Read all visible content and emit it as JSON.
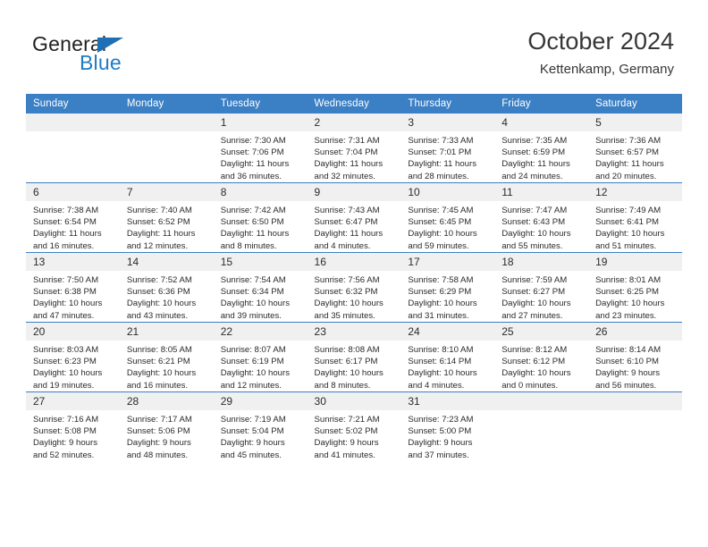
{
  "brand": {
    "name_top": "General",
    "name_bottom": "Blue",
    "accent_color": "#1f7ac4",
    "triangle_color": "#1f6fb5"
  },
  "header": {
    "title": "October 2024",
    "subtitle": "Kettenkamp, Germany"
  },
  "theme": {
    "header_row_bg": "#3b7fc4",
    "header_row_text": "#ffffff",
    "daynum_bg": "#f0f0f0",
    "cell_bg": "#ffffff",
    "row_rule": "#3b7fc4"
  },
  "weekday_headers": [
    "Sunday",
    "Monday",
    "Tuesday",
    "Wednesday",
    "Thursday",
    "Friday",
    "Saturday"
  ],
  "weeks": [
    [
      {
        "day": "",
        "empty": true,
        "lines": []
      },
      {
        "day": "",
        "empty": true,
        "lines": []
      },
      {
        "day": "1",
        "lines": [
          "Sunrise: 7:30 AM",
          "Sunset: 7:06 PM",
          "Daylight: 11 hours",
          "and 36 minutes."
        ]
      },
      {
        "day": "2",
        "lines": [
          "Sunrise: 7:31 AM",
          "Sunset: 7:04 PM",
          "Daylight: 11 hours",
          "and 32 minutes."
        ]
      },
      {
        "day": "3",
        "lines": [
          "Sunrise: 7:33 AM",
          "Sunset: 7:01 PM",
          "Daylight: 11 hours",
          "and 28 minutes."
        ]
      },
      {
        "day": "4",
        "lines": [
          "Sunrise: 7:35 AM",
          "Sunset: 6:59 PM",
          "Daylight: 11 hours",
          "and 24 minutes."
        ]
      },
      {
        "day": "5",
        "lines": [
          "Sunrise: 7:36 AM",
          "Sunset: 6:57 PM",
          "Daylight: 11 hours",
          "and 20 minutes."
        ]
      }
    ],
    [
      {
        "day": "6",
        "lines": [
          "Sunrise: 7:38 AM",
          "Sunset: 6:54 PM",
          "Daylight: 11 hours",
          "and 16 minutes."
        ]
      },
      {
        "day": "7",
        "lines": [
          "Sunrise: 7:40 AM",
          "Sunset: 6:52 PM",
          "Daylight: 11 hours",
          "and 12 minutes."
        ]
      },
      {
        "day": "8",
        "lines": [
          "Sunrise: 7:42 AM",
          "Sunset: 6:50 PM",
          "Daylight: 11 hours",
          "and 8 minutes."
        ]
      },
      {
        "day": "9",
        "lines": [
          "Sunrise: 7:43 AM",
          "Sunset: 6:47 PM",
          "Daylight: 11 hours",
          "and 4 minutes."
        ]
      },
      {
        "day": "10",
        "lines": [
          "Sunrise: 7:45 AM",
          "Sunset: 6:45 PM",
          "Daylight: 10 hours",
          "and 59 minutes."
        ]
      },
      {
        "day": "11",
        "lines": [
          "Sunrise: 7:47 AM",
          "Sunset: 6:43 PM",
          "Daylight: 10 hours",
          "and 55 minutes."
        ]
      },
      {
        "day": "12",
        "lines": [
          "Sunrise: 7:49 AM",
          "Sunset: 6:41 PM",
          "Daylight: 10 hours",
          "and 51 minutes."
        ]
      }
    ],
    [
      {
        "day": "13",
        "lines": [
          "Sunrise: 7:50 AM",
          "Sunset: 6:38 PM",
          "Daylight: 10 hours",
          "and 47 minutes."
        ]
      },
      {
        "day": "14",
        "lines": [
          "Sunrise: 7:52 AM",
          "Sunset: 6:36 PM",
          "Daylight: 10 hours",
          "and 43 minutes."
        ]
      },
      {
        "day": "15",
        "lines": [
          "Sunrise: 7:54 AM",
          "Sunset: 6:34 PM",
          "Daylight: 10 hours",
          "and 39 minutes."
        ]
      },
      {
        "day": "16",
        "lines": [
          "Sunrise: 7:56 AM",
          "Sunset: 6:32 PM",
          "Daylight: 10 hours",
          "and 35 minutes."
        ]
      },
      {
        "day": "17",
        "lines": [
          "Sunrise: 7:58 AM",
          "Sunset: 6:29 PM",
          "Daylight: 10 hours",
          "and 31 minutes."
        ]
      },
      {
        "day": "18",
        "lines": [
          "Sunrise: 7:59 AM",
          "Sunset: 6:27 PM",
          "Daylight: 10 hours",
          "and 27 minutes."
        ]
      },
      {
        "day": "19",
        "lines": [
          "Sunrise: 8:01 AM",
          "Sunset: 6:25 PM",
          "Daylight: 10 hours",
          "and 23 minutes."
        ]
      }
    ],
    [
      {
        "day": "20",
        "lines": [
          "Sunrise: 8:03 AM",
          "Sunset: 6:23 PM",
          "Daylight: 10 hours",
          "and 19 minutes."
        ]
      },
      {
        "day": "21",
        "lines": [
          "Sunrise: 8:05 AM",
          "Sunset: 6:21 PM",
          "Daylight: 10 hours",
          "and 16 minutes."
        ]
      },
      {
        "day": "22",
        "lines": [
          "Sunrise: 8:07 AM",
          "Sunset: 6:19 PM",
          "Daylight: 10 hours",
          "and 12 minutes."
        ]
      },
      {
        "day": "23",
        "lines": [
          "Sunrise: 8:08 AM",
          "Sunset: 6:17 PM",
          "Daylight: 10 hours",
          "and 8 minutes."
        ]
      },
      {
        "day": "24",
        "lines": [
          "Sunrise: 8:10 AM",
          "Sunset: 6:14 PM",
          "Daylight: 10 hours",
          "and 4 minutes."
        ]
      },
      {
        "day": "25",
        "lines": [
          "Sunrise: 8:12 AM",
          "Sunset: 6:12 PM",
          "Daylight: 10 hours",
          "and 0 minutes."
        ]
      },
      {
        "day": "26",
        "lines": [
          "Sunrise: 8:14 AM",
          "Sunset: 6:10 PM",
          "Daylight: 9 hours",
          "and 56 minutes."
        ]
      }
    ],
    [
      {
        "day": "27",
        "lines": [
          "Sunrise: 7:16 AM",
          "Sunset: 5:08 PM",
          "Daylight: 9 hours",
          "and 52 minutes."
        ]
      },
      {
        "day": "28",
        "lines": [
          "Sunrise: 7:17 AM",
          "Sunset: 5:06 PM",
          "Daylight: 9 hours",
          "and 48 minutes."
        ]
      },
      {
        "day": "29",
        "lines": [
          "Sunrise: 7:19 AM",
          "Sunset: 5:04 PM",
          "Daylight: 9 hours",
          "and 45 minutes."
        ]
      },
      {
        "day": "30",
        "lines": [
          "Sunrise: 7:21 AM",
          "Sunset: 5:02 PM",
          "Daylight: 9 hours",
          "and 41 minutes."
        ]
      },
      {
        "day": "31",
        "lines": [
          "Sunrise: 7:23 AM",
          "Sunset: 5:00 PM",
          "Daylight: 9 hours",
          "and 37 minutes."
        ]
      },
      {
        "day": "",
        "empty": true,
        "lines": []
      },
      {
        "day": "",
        "empty": true,
        "lines": []
      }
    ]
  ]
}
